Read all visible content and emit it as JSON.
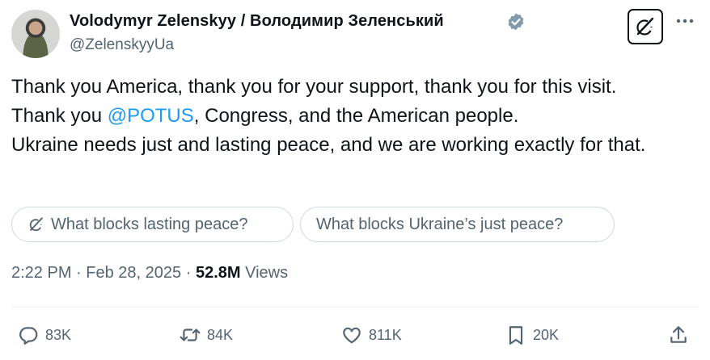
{
  "author": {
    "display_name": "Volodymyr Zelenskyy / Володимир Зеленський",
    "handle": "@ZelenskyyUa",
    "verified": true,
    "verified_color": "#829aab"
  },
  "header_icons": {
    "grok": "grok-icon",
    "more": "more-icon"
  },
  "tweet": {
    "line1": "Thank you America, thank you for your support, thank you for this visit.",
    "line2_pre": "Thank you ",
    "mention": "@POTUS",
    "line2_post": ", Congress, and the American people.",
    "line3": "Ukraine needs just and lasting peace, and we are working exactly for that.",
    "mention_color": "#1d9bf0"
  },
  "suggestions": [
    {
      "label": "What blocks lasting peace?",
      "icon": "grok-icon"
    },
    {
      "label": "What blocks Ukraine’s just peace?"
    }
  ],
  "meta": {
    "time": "2:22 PM",
    "separator": "·",
    "date": "Feb 28, 2025",
    "views_count": "52.8M",
    "views_label": "Views"
  },
  "actions": {
    "replies": "83K",
    "reposts": "84K",
    "likes": "811K",
    "bookmarks": "20K"
  }
}
